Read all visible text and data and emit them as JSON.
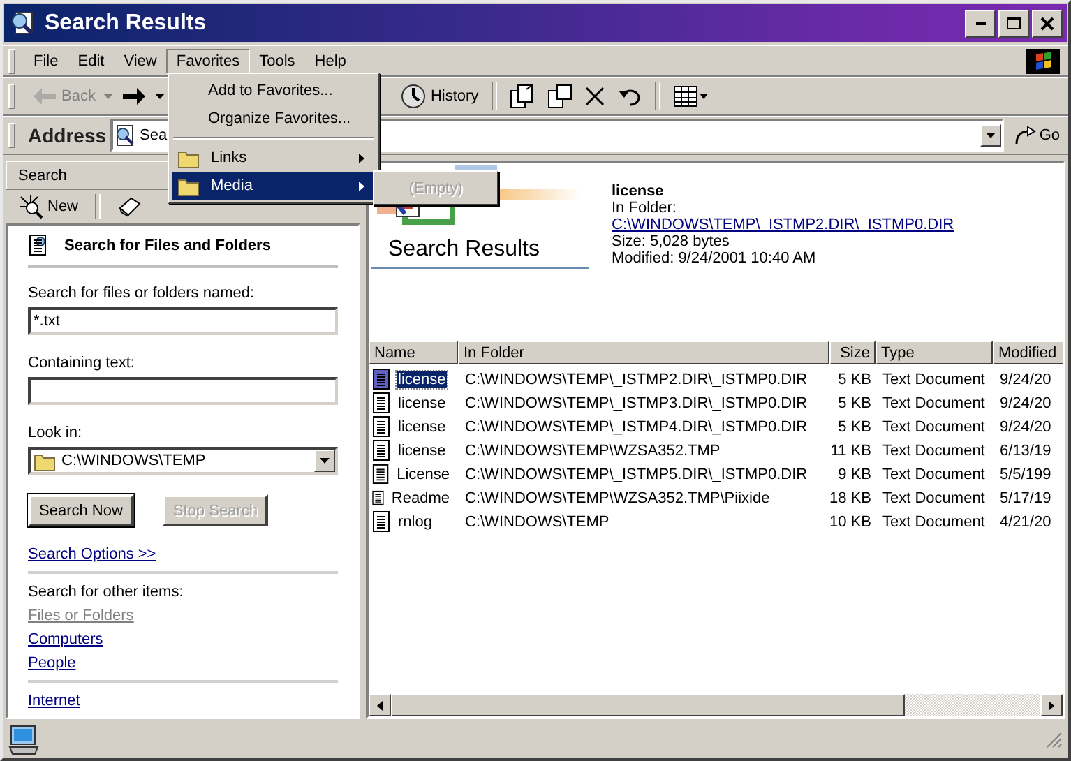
{
  "window": {
    "title": "Search Results"
  },
  "menu_bar": [
    {
      "label": "File",
      "selected": false
    },
    {
      "label": "Edit",
      "selected": false
    },
    {
      "label": "View",
      "selected": false
    },
    {
      "label": "Favorites",
      "selected": true
    },
    {
      "label": "Tools",
      "selected": false
    },
    {
      "label": "Help",
      "selected": false
    }
  ],
  "favorites_menu": {
    "items": [
      {
        "kind": "command",
        "label": "Add to Favorites...",
        "selected": false
      },
      {
        "kind": "command",
        "label": "Organize Favorites...",
        "selected": false
      },
      {
        "kind": "separator"
      },
      {
        "kind": "folder",
        "label": "Links",
        "selected": false
      },
      {
        "kind": "folder",
        "label": "Media",
        "selected": true
      }
    ],
    "submenu": [
      {
        "label": "(Empty)",
        "disabled": true
      }
    ]
  },
  "toolbar": [
    {
      "kind": "back",
      "label": "Back",
      "disabled": true
    },
    {
      "kind": "forward",
      "disabled": false
    },
    {
      "kind": "history",
      "label": "History",
      "disabled": false
    },
    {
      "kind": "move",
      "disabled": false
    },
    {
      "kind": "copy",
      "disabled": false
    },
    {
      "kind": "delete",
      "disabled": false
    },
    {
      "kind": "undo",
      "disabled": false
    },
    {
      "kind": "views",
      "disabled": false
    }
  ],
  "address_bar": {
    "label": "Address",
    "value": "Sea",
    "go": "Go"
  },
  "search_pane": {
    "title": "Search",
    "new_button": "New",
    "heading": "Search for Files and Folders",
    "name_label": "Search for files or folders named:",
    "name_value": "*.txt",
    "text_label": "Containing text:",
    "look_in_label": "Look in:",
    "look_in_value": "C:\\WINDOWS\\TEMP",
    "buttons": [
      {
        "label": "Search Now",
        "disabled": false
      },
      {
        "label": "Stop Search",
        "disabled": true
      }
    ],
    "options_link": "Search Options >>",
    "other_label": "Search for other items:",
    "other_items": [
      {
        "label": "Files or Folders",
        "disabled": true
      },
      {
        "label": "Computers",
        "disabled": false
      },
      {
        "label": "People",
        "disabled": false
      }
    ],
    "internet_link": "Internet"
  },
  "results": {
    "banner_title": "Search Results",
    "details": {
      "name": "license",
      "folder_label": "In Folder:",
      "folder_link": "C:\\WINDOWS\\TEMP\\_ISTMP2.DIR\\_ISTMP0.DIR",
      "size": "Size: 5,028 bytes",
      "modified": "Modified: 9/24/2001 10:40 AM"
    },
    "columns": [
      "Name",
      "In Folder",
      "Size",
      "Type",
      "Modified"
    ],
    "rows": [
      {
        "selected": true,
        "cells": [
          "license",
          "C:\\WINDOWS\\TEMP\\_ISTMP2.DIR\\_ISTMP0.DIR",
          "5 KB",
          "Text Document",
          "9/24/20"
        ]
      },
      {
        "selected": false,
        "cells": [
          "license",
          "C:\\WINDOWS\\TEMP\\_ISTMP3.DIR\\_ISTMP0.DIR",
          "5 KB",
          "Text Document",
          "9/24/20"
        ]
      },
      {
        "selected": false,
        "cells": [
          "license",
          "C:\\WINDOWS\\TEMP\\_ISTMP4.DIR\\_ISTMP0.DIR",
          "5 KB",
          "Text Document",
          "9/24/20"
        ]
      },
      {
        "selected": false,
        "cells": [
          "license",
          "C:\\WINDOWS\\TEMP\\WZSA352.TMP",
          "11 KB",
          "Text Document",
          "6/13/19"
        ]
      },
      {
        "selected": false,
        "cells": [
          "License",
          "C:\\WINDOWS\\TEMP\\_ISTMP5.DIR\\_ISTMP0.DIR",
          "9 KB",
          "Text Document",
          "5/5/199"
        ]
      },
      {
        "selected": false,
        "cells": [
          "Readme",
          "C:\\WINDOWS\\TEMP\\WZSA352.TMP\\Piixide",
          "18 KB",
          "Text Document",
          "5/17/19"
        ]
      },
      {
        "selected": false,
        "cells": [
          "rnlog",
          "C:\\WINDOWS\\TEMP",
          "10 KB",
          "Text Document",
          "4/21/20"
        ]
      }
    ]
  }
}
